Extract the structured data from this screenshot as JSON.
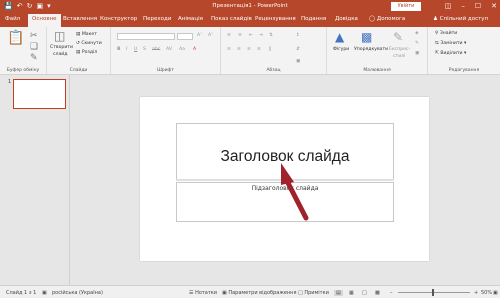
{
  "titlebar": {
    "title": "Презентація1  -  PowerPoint",
    "signin": "Увійти"
  },
  "tabs": [
    {
      "label": "Файл"
    },
    {
      "label": "Основне"
    },
    {
      "label": "Вставлення"
    },
    {
      "label": "Конструктор"
    },
    {
      "label": "Переходи"
    },
    {
      "label": "Анімація"
    },
    {
      "label": "Показ слайдів"
    },
    {
      "label": "Рецензування"
    },
    {
      "label": "Подання"
    },
    {
      "label": "Довідка"
    }
  ],
  "tellme": "Допомога",
  "share": "Спільний доступ",
  "ribbon": {
    "clipboard": {
      "label": "Буфер обміну"
    },
    "slides": {
      "new_slide": "Створити",
      "new_slide2": "слайд",
      "layout": "Макет",
      "reset": "Скинути",
      "section": "Розділ",
      "label": "Слайди"
    },
    "font": {
      "label": "Шрифт"
    },
    "paragraph": {
      "label": "Абзац"
    },
    "drawing": {
      "shapes": "Фігури",
      "arrange": "Упорядкувати",
      "quick_styles": "Експрес-",
      "quick_styles2": "стилі",
      "label": "Малювання"
    },
    "editing": {
      "find": "Знайти",
      "replace": "Замінити",
      "select": "Виділити",
      "label": "Редагування"
    }
  },
  "thumbnails": {
    "num": "1"
  },
  "slide": {
    "title": "Заголовок слайда",
    "subtitle": "Підзаголовок слайда"
  },
  "status": {
    "slide": "Слайд 1 з 1",
    "language": "російська (Україна)",
    "notes": "Нотатки",
    "view": "Параметри відображення",
    "comments": "Примітки",
    "zoom": "50%"
  }
}
